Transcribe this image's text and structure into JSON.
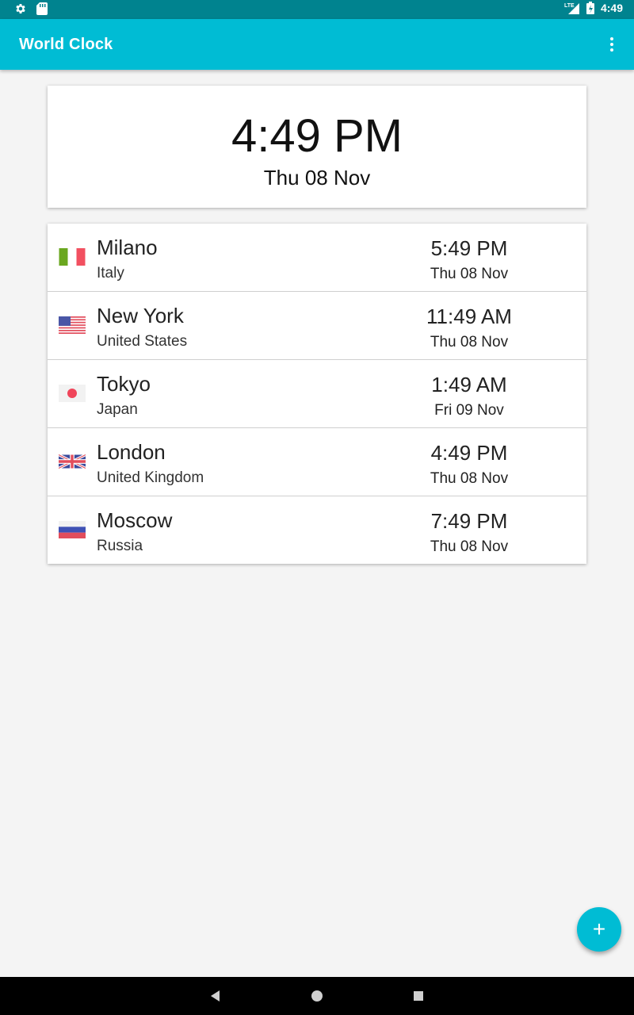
{
  "status_bar": {
    "time": "4:49",
    "network": "LTE",
    "icons": [
      "settings-icon",
      "sd-card-icon",
      "signal-icon",
      "battery-charging-icon"
    ]
  },
  "app_bar": {
    "title": "World Clock",
    "menu_icon": "more-vert-icon"
  },
  "local_clock": {
    "time": "4:49 PM",
    "date": "Thu 08 Nov"
  },
  "cities": [
    {
      "city": "Milano",
      "country": "Italy",
      "time": "5:49 PM",
      "date": "Thu 08 Nov",
      "flag": "italy-flag-icon"
    },
    {
      "city": "New York",
      "country": "United States",
      "time": "11:49 AM",
      "date": "Thu 08 Nov",
      "flag": "usa-flag-icon"
    },
    {
      "city": "Tokyo",
      "country": "Japan",
      "time": "1:49 AM",
      "date": "Fri 09 Nov",
      "flag": "japan-flag-icon"
    },
    {
      "city": "London",
      "country": "United Kingdom",
      "time": "4:49 PM",
      "date": "Thu 08 Nov",
      "flag": "uk-flag-icon"
    },
    {
      "city": "Moscow",
      "country": "Russia",
      "time": "7:49 PM",
      "date": "Thu 08 Nov",
      "flag": "russia-flag-icon"
    }
  ],
  "fab": {
    "icon": "add-icon",
    "label": "+"
  },
  "nav_bar": {
    "icons": [
      "back-icon",
      "home-icon",
      "recents-icon"
    ]
  },
  "colors": {
    "status_bar": "#00838f",
    "app_bar": "#00bcd4",
    "fab": "#00bcd4",
    "background": "#f4f4f4"
  }
}
